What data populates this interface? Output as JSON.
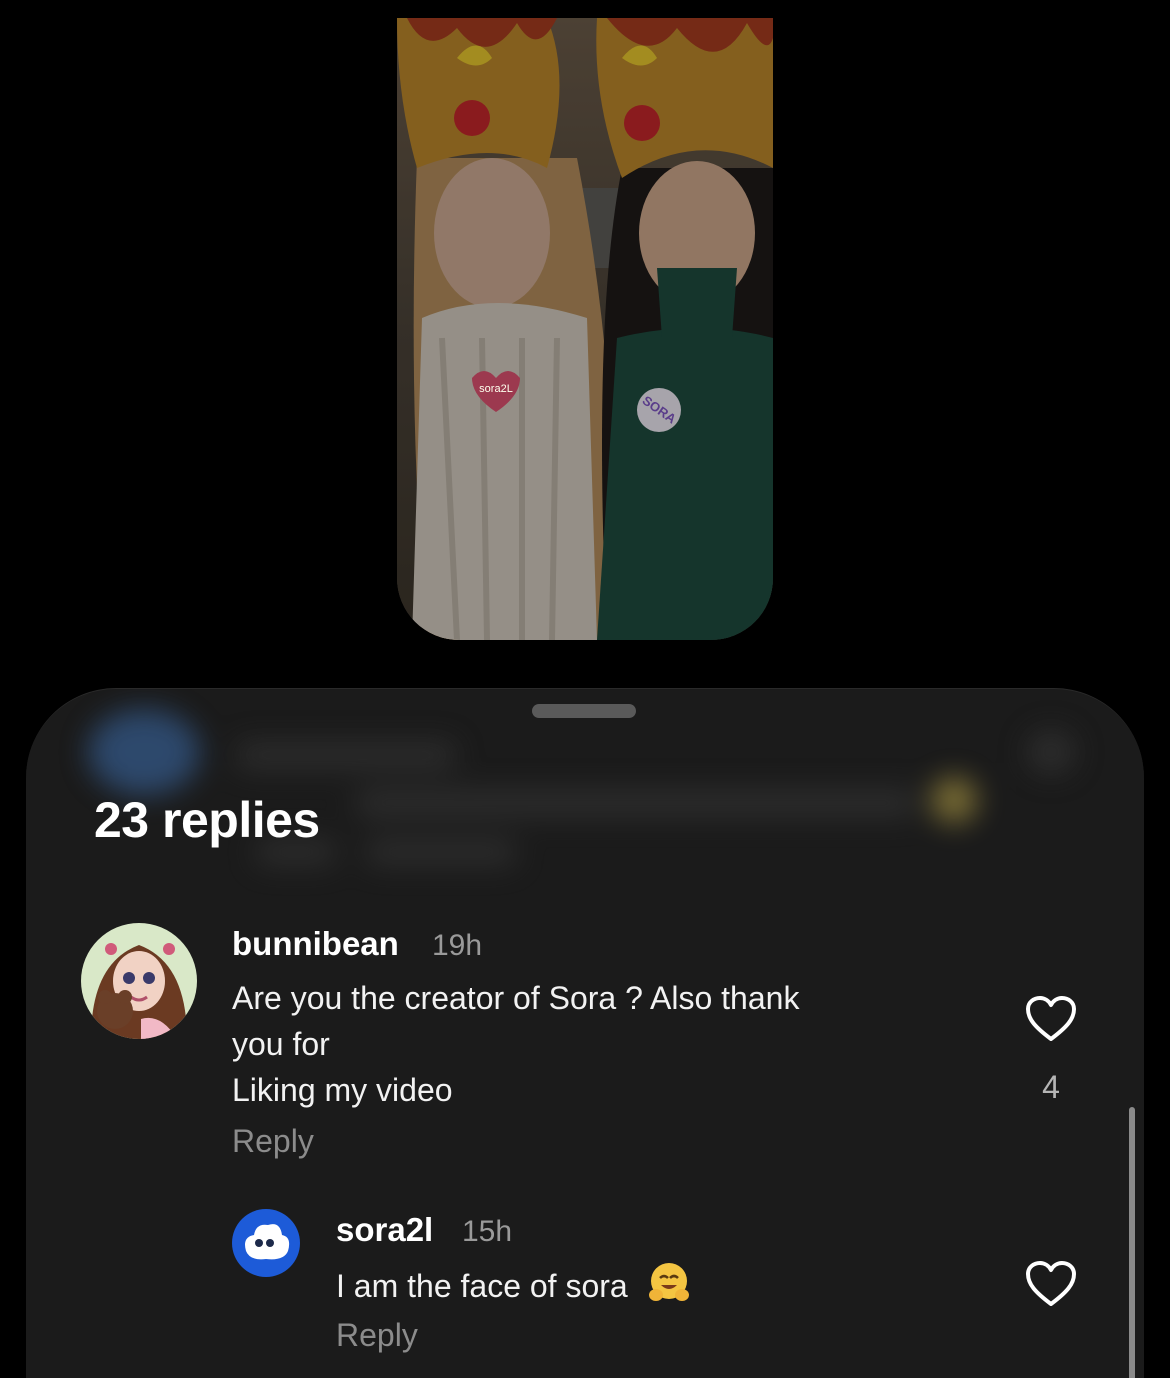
{
  "video": {
    "badge_left": "sora2L",
    "badge_right": "SORA"
  },
  "sheet": {
    "title": "23 replies"
  },
  "comments": [
    {
      "author": "bunnibean",
      "time": "19h",
      "lines": [
        "Are you the creator of Sora ? Also thank",
        "you for",
        "Liking my video"
      ],
      "reply_label": "Reply",
      "likes": "4",
      "avatar_icon": "anime-girl-avatar",
      "like_icon": "heart-outline-icon"
    },
    {
      "author": "sora2l",
      "time": "15h",
      "text": "I am the face of sora",
      "emoji": "hugging-face-emoji",
      "reply_label": "Reply",
      "avatar_icon": "blue-cloud-avatar",
      "like_icon": "heart-outline-icon"
    }
  ],
  "colors": {
    "background": "#000000",
    "sheet": "#1b1b1b",
    "text_primary": "#ffffff",
    "text_secondary": "#8c8c8c"
  }
}
